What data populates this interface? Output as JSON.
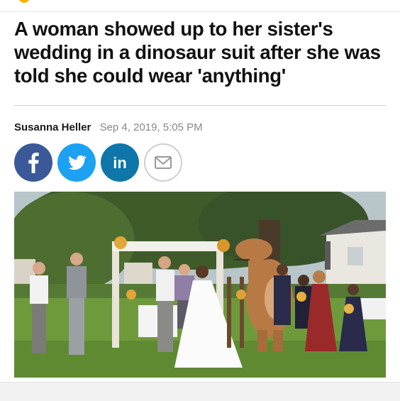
{
  "article": {
    "headline": "A woman showed up to her sister's wedding in a dinosaur suit after she was told she could wear 'anything'",
    "author": "Susanna Heller",
    "date": "Sep 4, 2019, 5:05 PM"
  },
  "share": {
    "facebook_icon": "facebook-icon",
    "twitter_icon": "twitter-icon",
    "linkedin_icon": "linkedin-icon",
    "email_icon": "email-icon",
    "colors": {
      "facebook": "#3b5998",
      "twitter": "#1da1f2",
      "linkedin": "#0e76a8",
      "email_border": "#cfcfcf"
    }
  },
  "photo": {
    "subject": "wedding-ceremony-with-dinosaur-costume"
  }
}
